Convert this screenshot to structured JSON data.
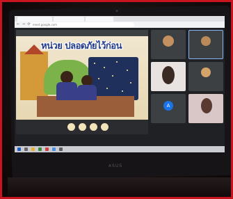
{
  "browser": {
    "tabs": [
      "",
      "",
      ""
    ],
    "url": "meet.google.com"
  },
  "meeting": {
    "presenter_header": "",
    "slide_title": "หน่วย ปลอดภัยไว้ก่อน",
    "participants": [
      {
        "name": "",
        "avatar_color": "#c59060"
      },
      {
        "name": "",
        "avatar_color": "#b88a5a"
      },
      {
        "name": "",
        "avatar_color": "#f0e8e6"
      },
      {
        "name": "",
        "avatar_color": "#d6a36a"
      },
      {
        "name": "A",
        "avatar_color": "#1a73e8"
      },
      {
        "name": "",
        "avatar_color": "#d9c6c6"
      }
    ],
    "bottom_text": "",
    "notification": ""
  },
  "device": {
    "brand": "ASUS"
  },
  "colors": {
    "frame": "#c8141e",
    "meet_bg": "#202124",
    "slide_title": "#223a8c",
    "end_call": "#e0453a"
  }
}
